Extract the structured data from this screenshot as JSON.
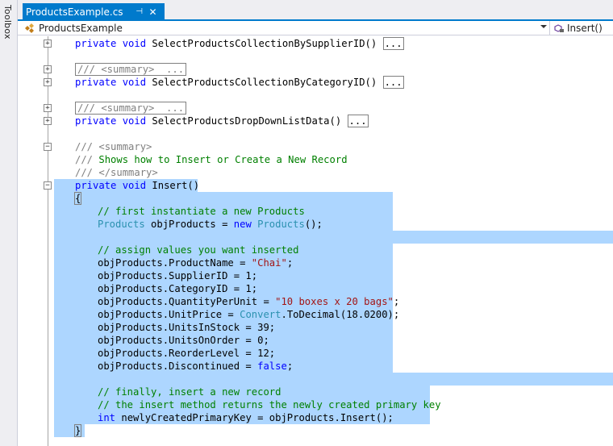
{
  "toolbox": {
    "label": "Toolbox"
  },
  "tab": {
    "title": "ProductsExample.cs",
    "pin_glyph": "⊣",
    "close_glyph": "✕"
  },
  "navbar": {
    "class_name": "ProductsExample",
    "member_name": "Insert()"
  },
  "colors": {
    "accent": "#007acc",
    "selection": "#add6ff",
    "keyword": "#0000ff",
    "comment": "#008000",
    "string": "#a31515",
    "type": "#2b91af",
    "doc_comment_gray": "#808080"
  },
  "code": {
    "l1_kw": "private void ",
    "l1_name": "SelectProductsCollectionBySupplierID()",
    "collapsed": "...",
    "summary_collapsed": "/// <summary>  ...",
    "l3_kw": "private void ",
    "l3_name": "SelectProductsCollectionByCategoryID()",
    "l5_kw": "private void ",
    "l5_name": "SelectProductsDropDownListData()",
    "doc_open_prefix": "/// ",
    "doc_open_tag": "<summary>",
    "doc_text_prefix": "///",
    "doc_text": " Shows how to Insert or Create a New Record",
    "doc_close_prefix": "/// ",
    "doc_close_tag": "</summary>",
    "insert_kw": "private void ",
    "insert_name": "Insert()",
    "brace_open": "{",
    "c_first": "// first instantiate a new Products",
    "products_type": "Products",
    "obj_decl_a": " objProducts = ",
    "new_kw": "new",
    "space": " ",
    "obj_decl_b": "();",
    "c_assign": "// assign values you want inserted",
    "set_name_a": "objProducts.ProductName = ",
    "set_name_str": "\"Chai\"",
    "semi": ";",
    "set_supplier": "objProducts.SupplierID = 1;",
    "set_category": "objProducts.CategoryID = 1;",
    "set_qpu_a": "objProducts.QuantityPerUnit = ",
    "set_qpu_str": "\"10 boxes x 20 bags\"",
    "set_price_a": "objProducts.UnitPrice = ",
    "convert_type": "Convert",
    "set_price_b": ".ToDecimal(18.0200);",
    "set_stock": "objProducts.UnitsInStock = 39;",
    "set_order": "objProducts.UnitsOnOrder = 0;",
    "set_reorder": "objProducts.ReorderLevel = 12;",
    "set_disc_a": "objProducts.Discontinued = ",
    "false_kw": "false",
    "c_finally": "// finally, insert a new record",
    "c_method": "// the insert method returns the newly created primary key",
    "int_kw": "int",
    "key_decl": " newlyCreatedPrimaryKey = objProducts.Insert();",
    "brace_close": "}"
  }
}
